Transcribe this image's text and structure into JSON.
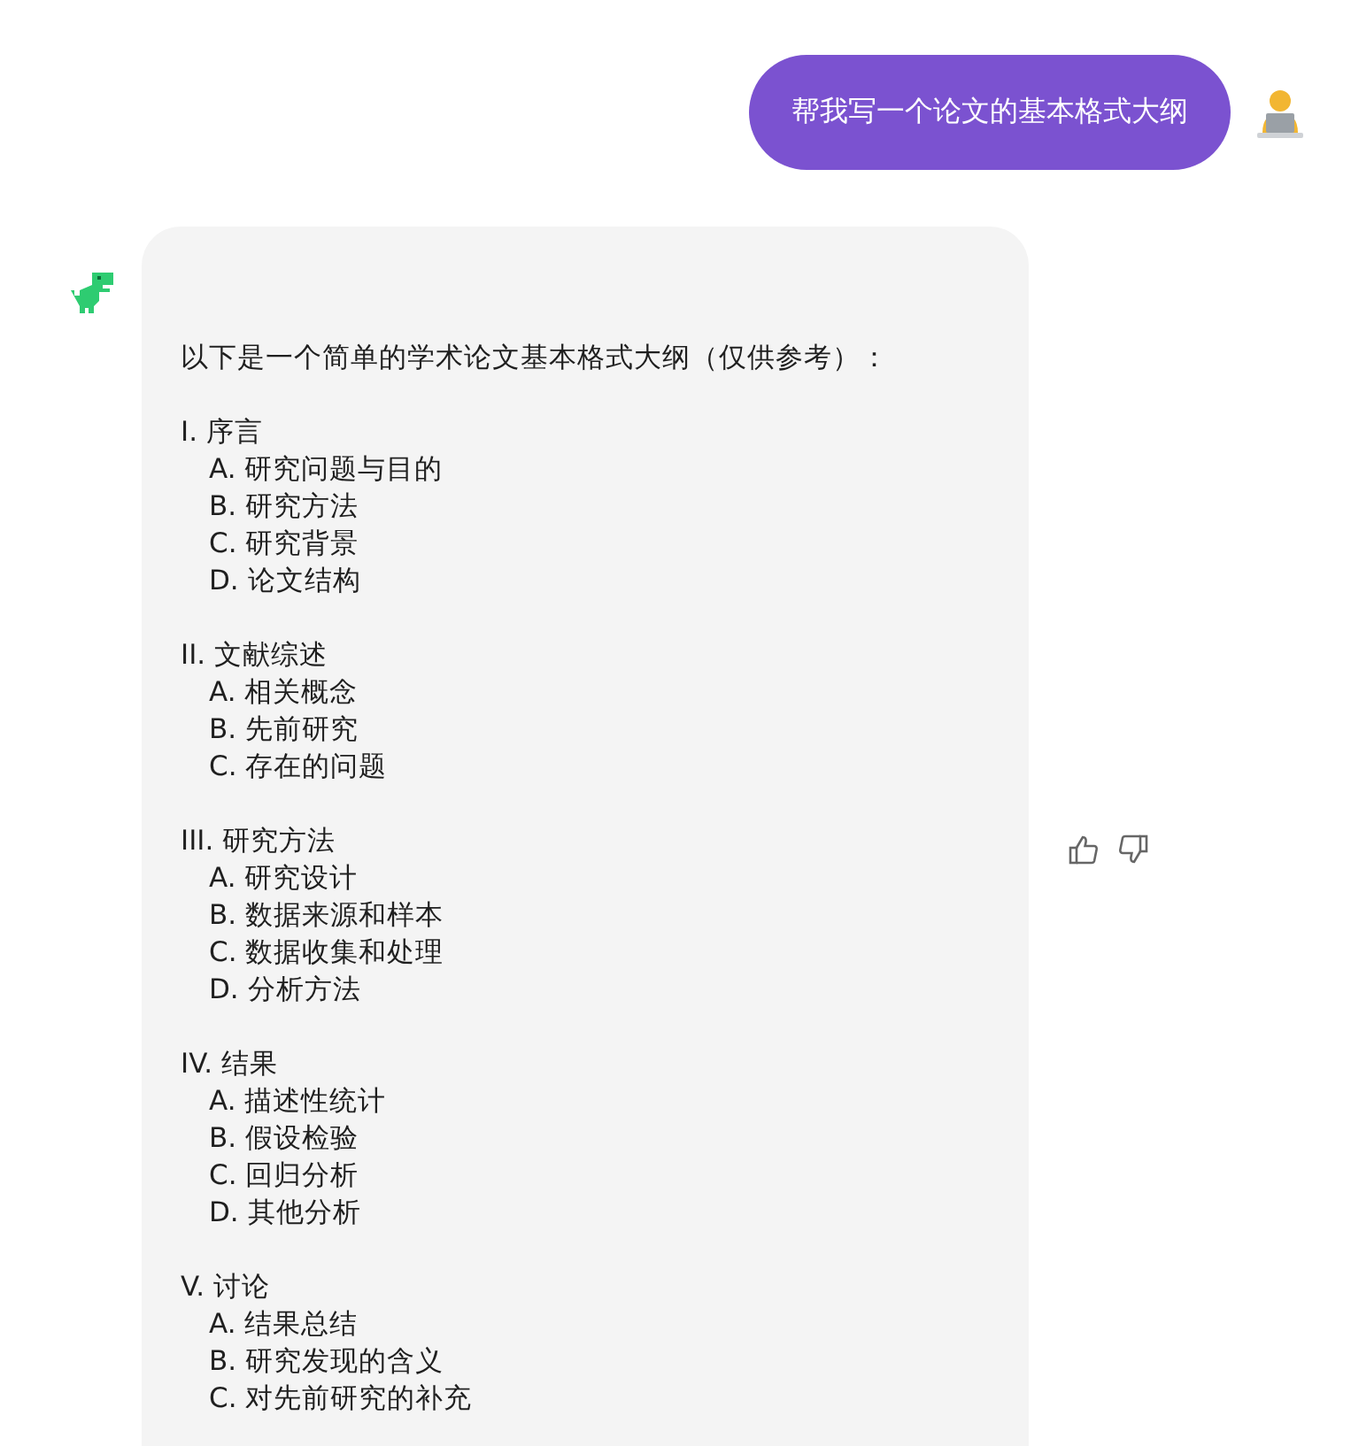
{
  "user_message": {
    "text": "帮我写一个论文的基本格式大纲"
  },
  "bot_message": {
    "intro": "以下是一个简单的学术论文基本格式大纲（仅供参考）：",
    "sections": [
      {
        "heading": "I. 序言",
        "items": [
          "A. 研究问题与目的",
          "B. 研究方法",
          "C. 研究背景",
          "D. 论文结构"
        ]
      },
      {
        "heading": "II. 文献综述",
        "items": [
          "A. 相关概念",
          "B. 先前研究",
          "C. 存在的问题"
        ]
      },
      {
        "heading": "III. 研究方法",
        "items": [
          "A. 研究设计",
          "B. 数据来源和样本",
          "C. 数据收集和处理",
          "D. 分析方法"
        ]
      },
      {
        "heading": "IV. 结果",
        "items": [
          "A. 描述性统计",
          "B. 假设检验",
          "C. 回归分析",
          "D. 其他分析"
        ]
      },
      {
        "heading": "V. 讨论",
        "items": [
          "A. 结果总结",
          "B. 研究发现的含义",
          "C. 对先前研究的补充"
        ]
      }
    ]
  }
}
